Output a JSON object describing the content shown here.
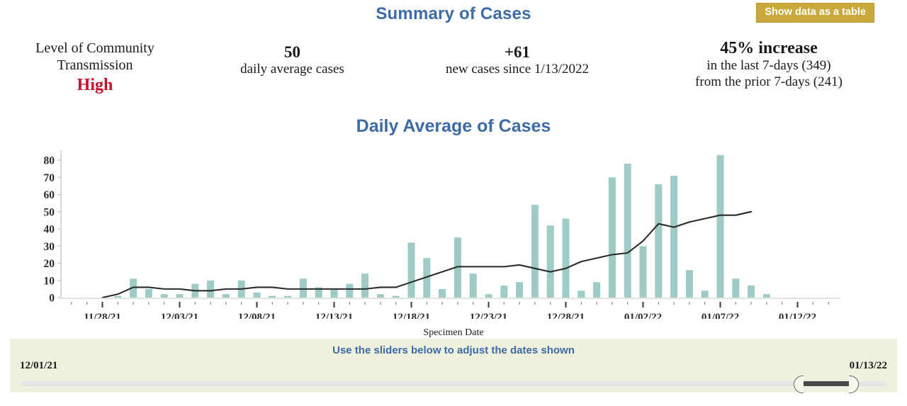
{
  "header": {
    "title": "Summary of Cases",
    "show_table_button": "Show data as a table",
    "title_color": "#3c6ba5",
    "button_color": "#c9a93c"
  },
  "stats": {
    "level": {
      "label_line1": "Level of Community",
      "label_line2": "Transmission",
      "value": "High",
      "value_color": "#c8102e"
    },
    "daily_average": {
      "value": "50",
      "label": "daily average cases"
    },
    "new_cases": {
      "value": "+61",
      "label": "new cases since 1/13/2022"
    },
    "increase": {
      "value": "45% increase",
      "line1": "in the last 7-days (349)",
      "line2": "from the prior 7-days (241)"
    }
  },
  "chart": {
    "title": "Daily Average of Cases",
    "x_axis_title": "Specimen Date"
  },
  "slider": {
    "instruction": "Use the sliders below to adjust the dates shown",
    "start_label": "12/01/21",
    "end_label": "01/13/22"
  },
  "chart_data": {
    "type": "bar",
    "title": "Daily Average of Cases",
    "xlabel": "Specimen Date",
    "ylabel": "",
    "ylim": [
      0,
      85
    ],
    "yticks": [
      0,
      10,
      20,
      30,
      40,
      50,
      60,
      70,
      80
    ],
    "grid": false,
    "legend": "none",
    "bar_color": "#9fcbc6",
    "line_color": "#2b2b2b",
    "x_tick_labels": [
      "11/28/21",
      "12/03/21",
      "12/08/21",
      "12/13/21",
      "12/18/21",
      "12/23/21",
      "12/28/21",
      "01/02/22",
      "01/07/22",
      "01/12/22"
    ],
    "x_tick_dates": [
      "11/28/21",
      "12/03/21",
      "12/08/21",
      "12/13/21",
      "12/18/21",
      "12/23/21",
      "12/28/21",
      "01/02/22",
      "01/07/22",
      "01/12/22"
    ],
    "x": [
      "11/26/21",
      "11/27/21",
      "11/28/21",
      "11/29/21",
      "11/30/21",
      "12/01/21",
      "12/02/21",
      "12/03/21",
      "12/04/21",
      "12/05/21",
      "12/06/21",
      "12/07/21",
      "12/08/21",
      "12/09/21",
      "12/10/21",
      "12/11/21",
      "12/12/21",
      "12/13/21",
      "12/14/21",
      "12/15/21",
      "12/16/21",
      "12/17/21",
      "12/18/21",
      "12/19/21",
      "12/20/21",
      "12/21/21",
      "12/22/21",
      "12/23/21",
      "12/24/21",
      "12/25/21",
      "12/26/21",
      "12/27/21",
      "12/28/21",
      "12/29/21",
      "12/30/21",
      "12/31/21",
      "01/01/22",
      "01/02/22",
      "01/03/22",
      "01/04/22",
      "01/05/22",
      "01/06/22",
      "01/07/22",
      "01/08/22",
      "01/09/22",
      "01/10/22",
      "01/11/22",
      "01/12/22",
      "01/13/22",
      "01/14/22"
    ],
    "series": [
      {
        "name": "Daily cases",
        "type": "bar",
        "values": [
          0,
          0,
          0,
          1,
          11,
          5,
          2,
          2,
          8,
          10,
          2,
          10,
          3,
          1,
          1,
          11,
          6,
          5,
          8,
          14,
          2,
          1,
          32,
          23,
          5,
          35,
          14,
          2,
          7,
          9,
          54,
          42,
          46,
          4,
          9,
          70,
          78,
          30,
          66,
          71,
          16,
          4,
          83,
          11,
          7,
          2,
          0,
          0,
          0,
          0
        ]
      },
      {
        "name": "7-day daily average",
        "type": "line",
        "values": [
          null,
          null,
          0,
          2,
          6,
          6,
          5,
          5,
          4,
          4,
          5,
          5,
          6,
          6,
          5,
          5,
          5,
          5,
          5,
          5,
          6,
          6,
          9,
          12,
          15,
          18,
          18,
          18,
          18,
          19,
          17,
          15,
          17,
          21,
          23,
          25,
          26,
          33,
          43,
          41,
          44,
          46,
          48,
          48,
          50,
          null,
          null,
          null,
          null,
          null
        ]
      }
    ]
  }
}
